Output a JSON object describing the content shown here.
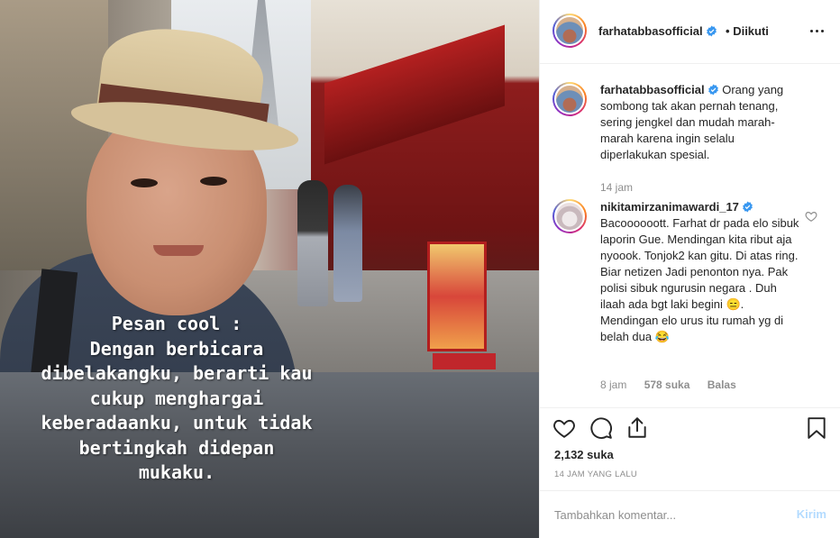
{
  "photo": {
    "caption": "Pesan cool :\nDengan berbicara\ndibelakangku, berarti kau\ncukup menghargai\nkeberadaanku, untuk tidak\nbertingkah didepan\nmukaku."
  },
  "header": {
    "username": "farhatabbasofficial",
    "separator": "•",
    "follow_status": "Diikuti",
    "more_icon": "more-horizontal-icon"
  },
  "comments": [
    {
      "username": "farhatabbasofficial",
      "verified": true,
      "text": "Orang yang sombong tak akan pernah tenang, sering jengkel dan mudah marah-marah karena ingin selalu diperlakukan spesial.",
      "time": "14 jam"
    },
    {
      "username": "nikitamirzanimawardi_17",
      "verified": true,
      "text": "Bacoooooott. Farhat dr pada elo sibuk laporin Gue. Mendingan kita ribut aja nyoook. Tonjok2 kan gitu. Di atas ring. Biar netizen Jadi penonton nya. Pak polisi sibuk ngurusin negara . Duh ilaah ada bgt laki begini 😑. Mendingan elo urus itu rumah yg di belah dua 😂",
      "time": "8 jam",
      "likes": "578 suka",
      "reply": "Balas"
    }
  ],
  "actions": {
    "icons": [
      "heart-icon",
      "comment-icon",
      "share-icon",
      "bookmark-icon"
    ],
    "likes": "2,132 suka",
    "timestamp": "14 JAM YANG LALU"
  },
  "composer": {
    "placeholder": "Tambahkan komentar...",
    "post_label": "Kirim"
  },
  "colors": {
    "verified": "#3897f0",
    "post_button_disabled": "#b3dbff",
    "muted_text": "#8e8e8e"
  }
}
